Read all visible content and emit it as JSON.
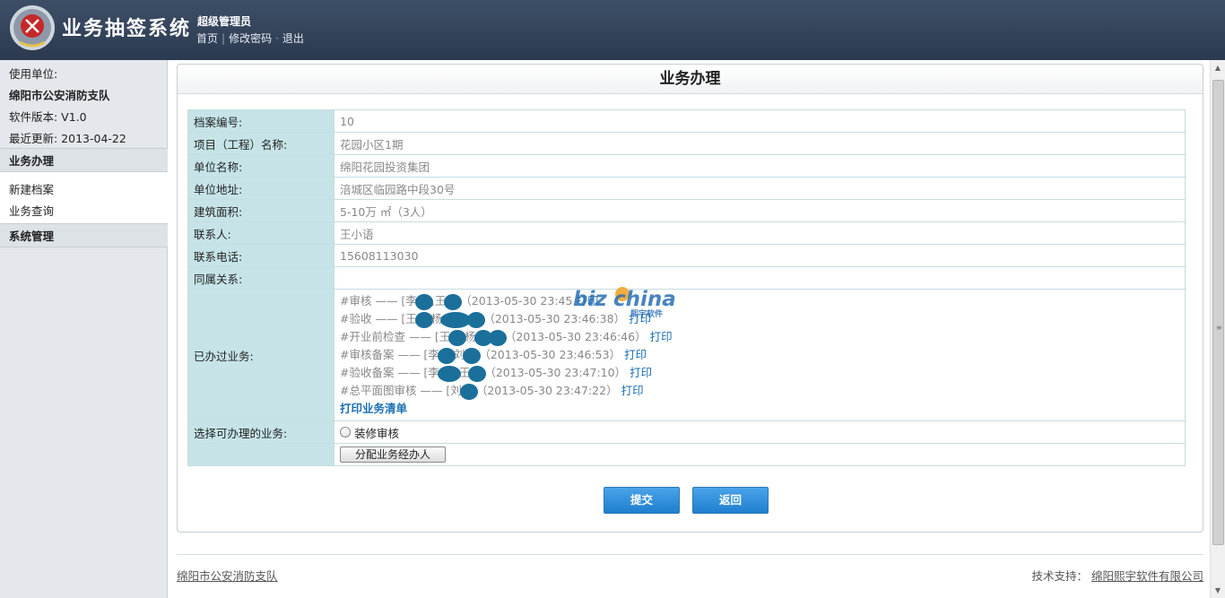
{
  "header": {
    "system_title": "业务抽签系统",
    "user_role": "超级管理员",
    "links": [
      "首页",
      "修改密码",
      "退出"
    ]
  },
  "sidebar": {
    "org_label": "使用单位:",
    "org_name": "绵阳市公安消防支队",
    "version": "软件版本: V1.0",
    "last_update": "最近更新: 2013-04-22",
    "section_business": "业务办理",
    "business_items": [
      "新建档案",
      "业务查询"
    ],
    "section_system": "系统管理"
  },
  "panel": {
    "title": "业务办理",
    "fields": [
      {
        "label": "档案编号:",
        "value": "10"
      },
      {
        "label": "项目（工程）名称:",
        "value": "花园小区1期"
      },
      {
        "label": "单位名称:",
        "value": "绵阳花园投资集团"
      },
      {
        "label": "单位地址:",
        "value": "涪城区临园路中段30号"
      },
      {
        "label": "建筑面积:",
        "value": "5-10万 ㎡（3人）"
      },
      {
        "label": "联系人:",
        "value": "王小语"
      },
      {
        "label": "联系电话:",
        "value": "15608113030"
      },
      {
        "label": "同属关系:",
        "value": ""
      }
    ],
    "done_label": "已办过业务:",
    "done_items": [
      {
        "prefix": "#审核 —— [李",
        "mid": ",王",
        "time": "（2013-05-30 23:45",
        "print": "打印"
      },
      {
        "prefix": "#验收 —— [王",
        "mid": "杨",
        "time": "（2013-05-30 23:46:38）",
        "print": "打印"
      },
      {
        "prefix": "#开业前检查 —— [王",
        "mid": "杨",
        "time": "（2013-05-30 23:46:46）",
        "print": "打印"
      },
      {
        "prefix": "#审核备案 —— [李",
        "mid": "刘",
        "time": "（2013-05-30 23:46:53）",
        "print": "打印"
      },
      {
        "prefix": "#验收备案 —— [李",
        "mid": "王",
        "time": "（2013-05-30 23:47:10）",
        "print": "打印"
      },
      {
        "prefix": "#总平面图审核 —— [刘",
        "mid": "",
        "time": "（2013-05-30 23:47:22）",
        "print": "打印"
      }
    ],
    "print_list": "打印业务清单",
    "select_label": "选择可办理的业务:",
    "select_option": "装修审核",
    "assign_button": "分配业务经办人",
    "submit_button": "提交",
    "back_button": "返回"
  },
  "watermark": {
    "brand": "bizchina",
    "sub": "熙宇软件"
  },
  "footer": {
    "left": "绵阳市公安消防支队",
    "support_label": "技术支持：",
    "support_company": "绵阳熙宇软件有限公司"
  },
  "colors": {
    "header_bg": "#33445c",
    "label_bg": "#c6e4e8",
    "button_blue": "#1f7fcf",
    "link": "#1a6fb4"
  }
}
